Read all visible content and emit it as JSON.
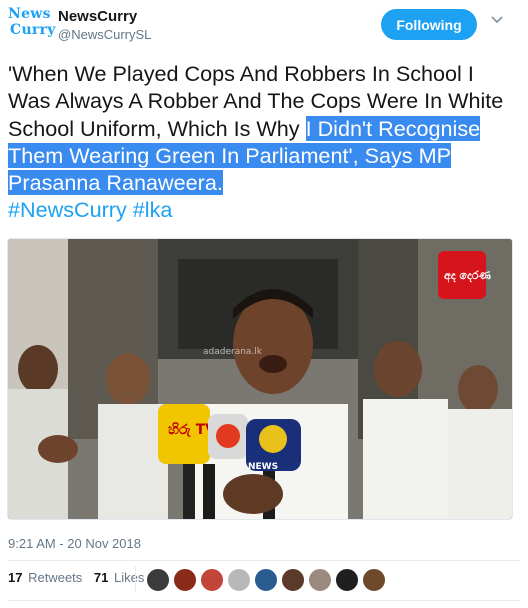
{
  "account": {
    "logo_line1": "News",
    "logo_line2": "Curry",
    "display_name": "NewsCurry",
    "handle": "@NewsCurrySL",
    "follow_label": "Following"
  },
  "tweet": {
    "text_plain": "'When We Played Cops And Robbers In School I Was Always A Robber And The Cops Were In White School Uniform, Which Is Why ",
    "text_highlighted": "I Didn't Recognise Them Wearing Green In Parliament', Says MP Prasanna Ranaweera.",
    "hashtag1": "#NewsCurry",
    "hashtag2": "#lka",
    "timestamp": "9:21 AM - 20 Nov 2018"
  },
  "media": {
    "description": "Man speaking into news microphones",
    "channel_logo_text": "අද දෙරණ",
    "watermark": "adaderana.lk",
    "mic_label_1": "හිරු TV",
    "mic_label_2": "NEWS"
  },
  "stats": {
    "retweets_count": "17",
    "retweets_label": "Retweets",
    "likes_count": "71",
    "likes_label": "Likes"
  },
  "avatars": [
    "avatar-1",
    "avatar-2",
    "avatar-3",
    "avatar-4",
    "avatar-5",
    "avatar-6",
    "avatar-7",
    "avatar-8",
    "avatar-9"
  ],
  "colors": {
    "accent": "#1da1f2",
    "highlight": "#3a8bef",
    "muted": "#657786"
  }
}
